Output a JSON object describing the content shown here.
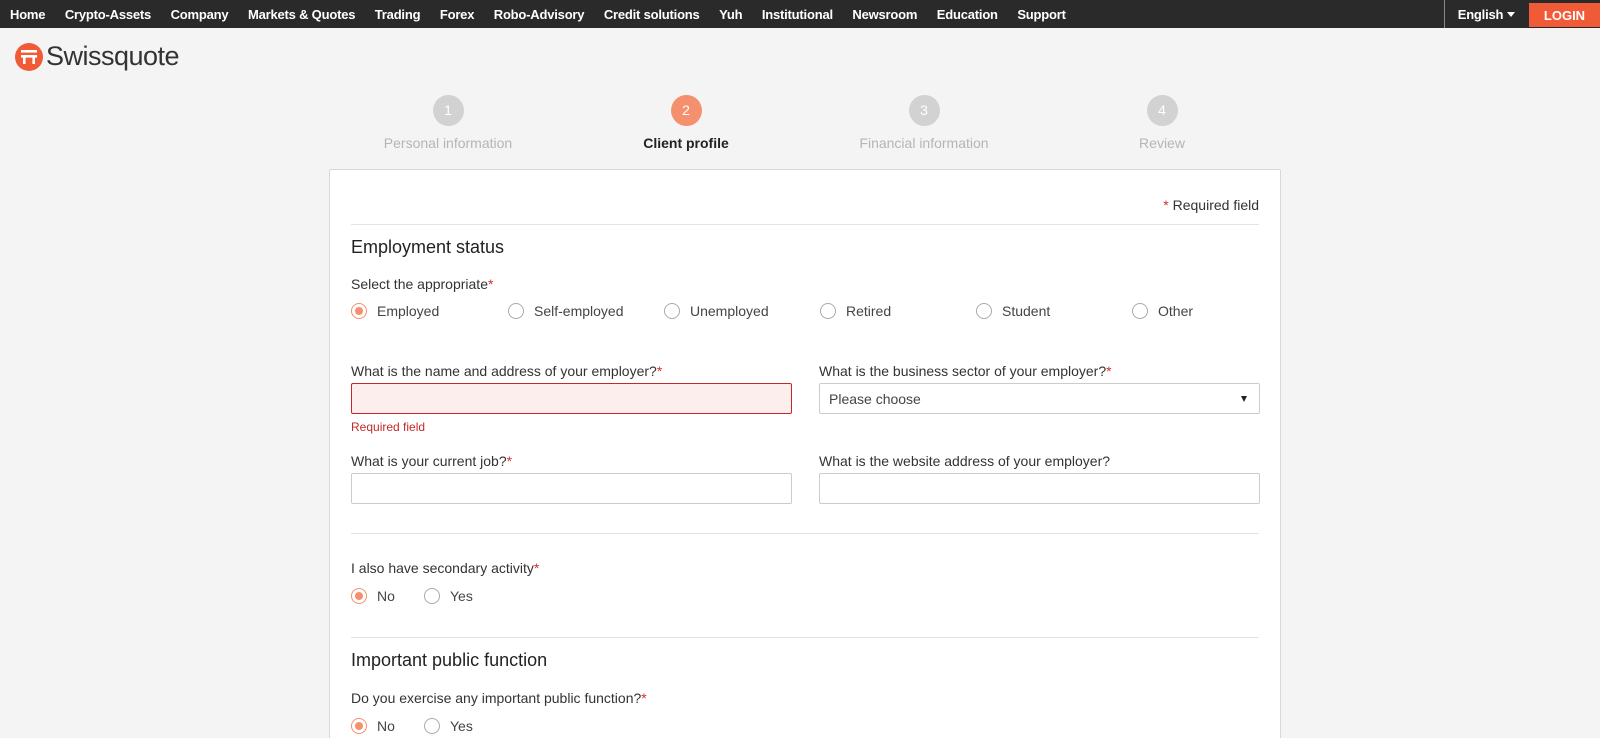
{
  "nav": {
    "links": [
      "Home",
      "Crypto-Assets",
      "Company",
      "Markets & Quotes",
      "Trading",
      "Forex",
      "Robo-Advisory",
      "Credit solutions",
      "Yuh",
      "Institutional",
      "Newsroom",
      "Education",
      "Support"
    ],
    "language": "English",
    "login": "LOGIN"
  },
  "brand": {
    "name": "Swissquote",
    "color": "#f15a36"
  },
  "steps": [
    {
      "number": "1",
      "label": "Personal information",
      "active": false
    },
    {
      "number": "2",
      "label": "Client profile",
      "active": true
    },
    {
      "number": "3",
      "label": "Financial information",
      "active": false
    },
    {
      "number": "4",
      "label": "Review",
      "active": false
    }
  ],
  "form": {
    "required_marker": "*",
    "required_note": "Required field",
    "employment": {
      "heading": "Employment status",
      "select_label": "Select the appropriate",
      "options": [
        "Employed",
        "Self-employed",
        "Unemployed",
        "Retired",
        "Student",
        "Other"
      ],
      "selected": "Employed"
    },
    "employer_name": {
      "label": "What is the name and address of your employer?",
      "value": "",
      "error": "Required field"
    },
    "business_sector": {
      "label": "What is the business sector of your employer?",
      "value": "Please choose"
    },
    "current_job": {
      "label": "What is your current job?",
      "value": ""
    },
    "employer_website": {
      "label": "What is the website address of your employer?",
      "value": ""
    },
    "secondary_activity": {
      "label": "I also have secondary activity",
      "options": [
        "No",
        "Yes"
      ],
      "selected": "No"
    },
    "public_function": {
      "heading": "Important public function",
      "question": "Do you exercise any important public function?",
      "options": [
        "No",
        "Yes"
      ],
      "selected": "No"
    }
  },
  "colors": {
    "accent": "#f5906f",
    "login": "#f15a36",
    "error": "#c62828",
    "nav_bg": "#2a2a2a"
  }
}
